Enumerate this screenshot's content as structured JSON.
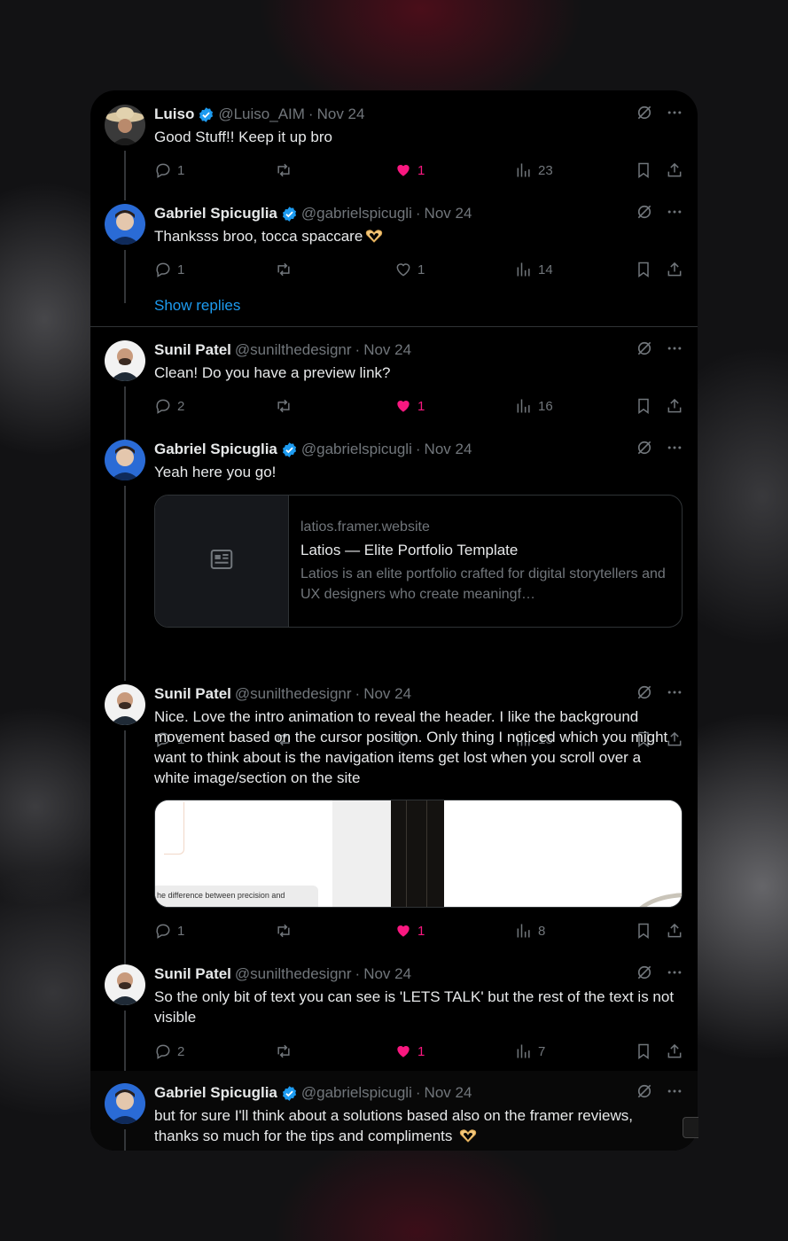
{
  "colors": {
    "accent": "#1d9bf0",
    "like": "#f91880",
    "muted": "#71767b",
    "text": "#e7e9ea"
  },
  "tweets": [
    {
      "name": "Luiso",
      "verified": true,
      "handle": "@Luiso_AIM",
      "time": "Nov 24",
      "text": "Good Stuff!! Keep it up bro",
      "replies": "1",
      "likes": "1",
      "liked": true,
      "views": "23"
    },
    {
      "name": "Gabriel Spicuglia",
      "verified": true,
      "handle": "@gabrielspicugli",
      "time": "Nov 24",
      "text": "Thanksss broo, tocca spaccare",
      "emoji": "heart-hands-emoji",
      "replies": "1",
      "likes": "1",
      "liked": false,
      "views": "14"
    },
    {
      "name": "Sunil Patel",
      "verified": false,
      "handle": "@sunilthedesignr",
      "time": "Nov 24",
      "text": "Clean! Do you have a preview link?",
      "replies": "2",
      "likes": "1",
      "liked": true,
      "views": "16"
    },
    {
      "name": "Gabriel Spicuglia",
      "verified": true,
      "handle": "@gabrielspicugli",
      "time": "Nov 24",
      "text": "Yeah here you go!",
      "replies": "1",
      "likes": "",
      "liked": false,
      "views": "15"
    },
    {
      "name": "Sunil Patel",
      "verified": false,
      "handle": "@sunilthedesignr",
      "time": "Nov 24",
      "text": "Nice. Love the intro animation to reveal the header. I like the background movement based on the cursor position. Only thing I noticed which you might want to think about is the navigation items get lost when you scroll over a white image/section on the site",
      "replies": "1",
      "likes": "1",
      "liked": true,
      "views": "8"
    },
    {
      "name": "Sunil Patel",
      "verified": false,
      "handle": "@sunilthedesignr",
      "time": "Nov 24",
      "text": "So the only bit of text you can see is 'LETS TALK' but the rest of the text is not visible",
      "replies": "2",
      "likes": "1",
      "liked": true,
      "views": "7"
    },
    {
      "name": "Gabriel Spicuglia",
      "verified": true,
      "handle": "@gabrielspicugli",
      "time": "Nov 24",
      "text": "but for sure I'll think about a solutions based also on the framer reviews, thanks so much for the tips and compliments",
      "emoji": "heart-hands-emoji"
    }
  ],
  "show_replies": "Show replies",
  "link_card": {
    "domain": "latios.framer.website",
    "title": "Latios — Elite Portfolio Template",
    "description": "Latios is an elite portfolio crafted for digital storytellers and UX designers who create meaningf…"
  },
  "media_text": "he difference between precision and"
}
